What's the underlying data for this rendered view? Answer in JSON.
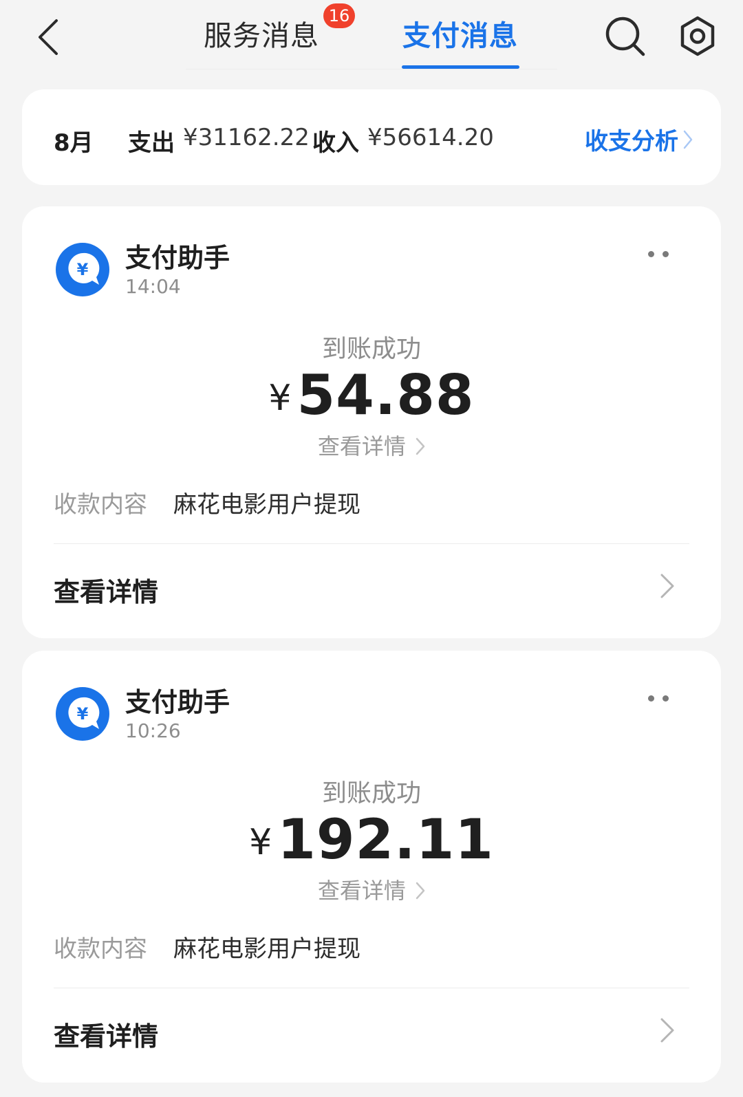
{
  "header": {
    "tabs": [
      {
        "label": "服务消息",
        "badge": "16",
        "active": false
      },
      {
        "label": "支付消息",
        "active": true
      }
    ],
    "icons": {
      "back": "chevron-left-icon",
      "search": "search-icon",
      "settings": "gear-icon"
    }
  },
  "summary": {
    "month": "8月",
    "expense_label": "支出",
    "expense_value": "¥31162.22",
    "income_label": "收入",
    "income_value": "¥56614.20",
    "analysis_link": "收支分析"
  },
  "messages": [
    {
      "sender": "支付助手",
      "time": "14:04",
      "status": "到账成功",
      "currency": "¥",
      "amount": "54.88",
      "detail_link": "查看详情",
      "content_label": "收款内容",
      "content_value": "麻花电影用户提现",
      "view_detail": "查看详情"
    },
    {
      "sender": "支付助手",
      "time": "10:26",
      "status": "到账成功",
      "currency": "¥",
      "amount": "192.11",
      "detail_link": "查看详情",
      "content_label": "收款内容",
      "content_value": "麻花电影用户提现",
      "view_detail": "查看详情"
    }
  ],
  "colors": {
    "accent": "#1a73e8",
    "badge": "#f0412c",
    "background": "#f4f4f4",
    "card": "#ffffff"
  }
}
